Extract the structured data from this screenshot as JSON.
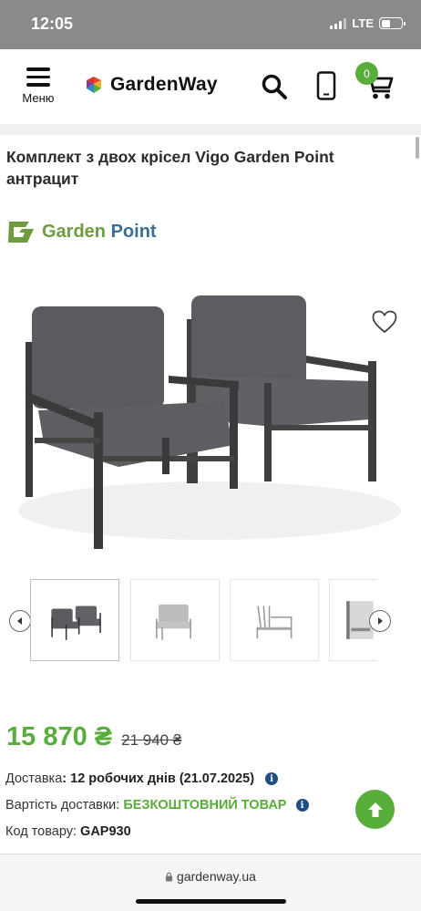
{
  "status": {
    "time": "12:05",
    "network": "LTE"
  },
  "header": {
    "menu_label": "Меню",
    "logo_text": "GardenWay",
    "cart_count": "0"
  },
  "product": {
    "title": "Комплект з двох крісел Vigo Garden Point антрацит",
    "brand": {
      "part1": "Garden",
      "part2": "Point"
    },
    "price": "15 870 ₴",
    "old_price": "21 940 ₴",
    "delivery": {
      "label": "Доставка",
      "value": "12 робочих днів (21.07.2025)"
    },
    "shipping_cost": {
      "label": "Вартість доставки:",
      "value": "БЕЗКОШТОВНИЙ ТОВАР"
    },
    "code": {
      "label": "Код товару:",
      "value": "GAP930"
    }
  },
  "gallery": {
    "thumbnails": [
      "two-chairs",
      "chair-frame-front",
      "chair-frame-side",
      "chair-detail"
    ],
    "active_index": 0
  },
  "browser": {
    "url": "gardenway.ua"
  },
  "colors": {
    "accent": "#59ad3a",
    "info": "#1f4d86",
    "status_bar": "#8a8a8a"
  }
}
